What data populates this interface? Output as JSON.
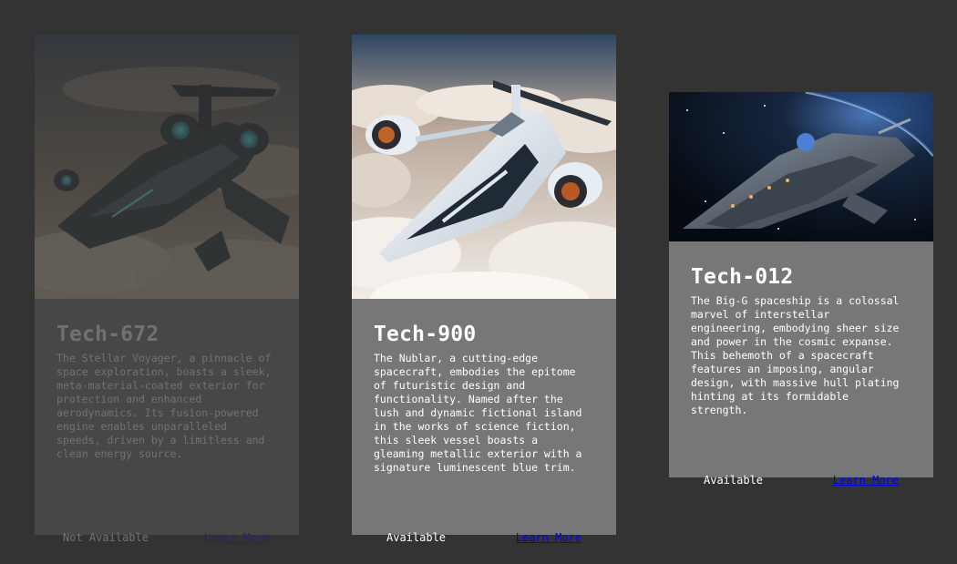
{
  "cards": [
    {
      "title": "Tech-672",
      "description": "The Stellar Voyager, a pinnacle of space exploration, boasts a sleek, meta-material-coated exterior for protection and enhanced aerodynamics. Its fusion-powered engine enables unparalleled speeds, driven by a limitless and clean energy source.",
      "status": "Not Available",
      "link_label": "Learn More"
    },
    {
      "title": "Tech-900",
      "description": "The Nublar, a cutting-edge spacecraft, embodies the epitome of futuristic design and functionality. Named after the lush and dynamic fictional island in the works of science fiction, this sleek vessel boasts a gleaming metallic exterior with a signature luminescent blue trim.",
      "status": "Available",
      "link_label": "Learn More"
    },
    {
      "title": "Tech-012",
      "description": "The Big-G spaceship is a colossal marvel of interstellar engineering, embodying sheer size and power in the cosmic expanse. This behemoth of a spacecraft features an imposing, angular design, with massive hull plating hinting at its formidable strength.",
      "status": "Available",
      "link_label": "Learn More"
    }
  ],
  "colors": {
    "page_background": "#333333",
    "card_background": "#777777",
    "link": "#0000ee"
  }
}
